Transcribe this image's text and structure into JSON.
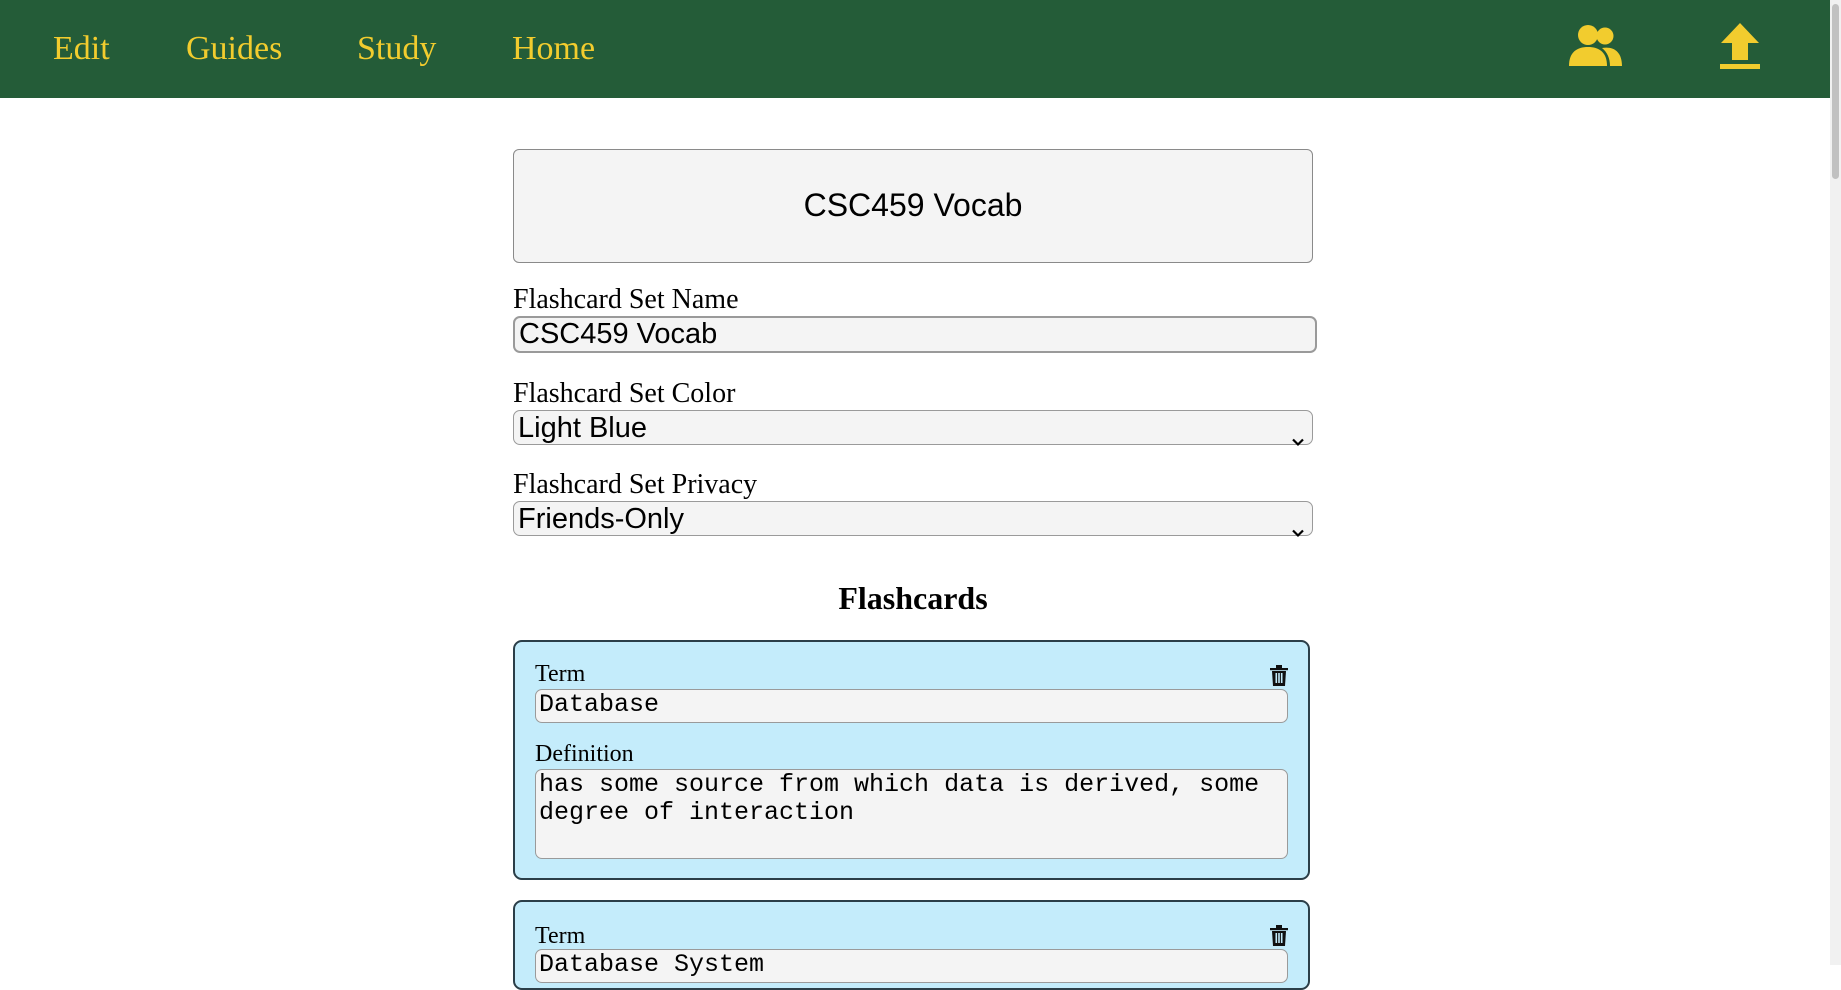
{
  "nav": {
    "links": [
      "Edit",
      "Guides",
      "Study",
      "Home"
    ],
    "icons": [
      "people-icon",
      "upload-icon"
    ]
  },
  "set": {
    "title": "CSC459 Vocab",
    "name_label": "Flashcard Set Name",
    "name_value": "CSC459 Vocab",
    "color_label": "Flashcard Set Color",
    "color_value": "Light Blue",
    "privacy_label": "Flashcard Set Privacy",
    "privacy_value": "Friends-Only"
  },
  "flashcards": {
    "heading": "Flashcards",
    "term_label": "Term",
    "definition_label": "Definition",
    "cards": [
      {
        "term": "Database",
        "definition": "has some source from which data is derived, some degree of interaction"
      },
      {
        "term": "Database System"
      }
    ]
  },
  "colors": {
    "nav_bg": "#245c38",
    "nav_text": "#f2cc2e",
    "card_bg": "#c4ecfb"
  }
}
